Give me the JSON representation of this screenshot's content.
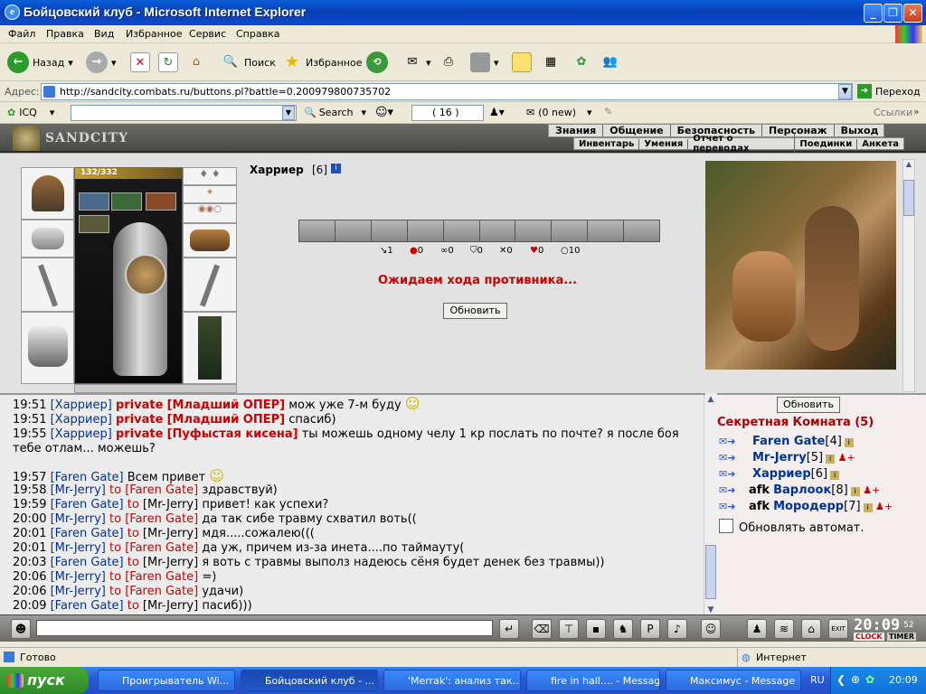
{
  "window": {
    "title": "Бойцовский клуб - Microsoft Internet Explorer"
  },
  "menu": [
    "Файл",
    "Правка",
    "Вид",
    "Избранное",
    "Сервис",
    "Справка"
  ],
  "toolbar": {
    "back": "Назад",
    "search": "Поиск",
    "favorites": "Избранное"
  },
  "address": {
    "label": "Адрес:",
    "url": "http://sandcity.combats.ru/buttons.pl?battle=0.200979800735702",
    "go": "Переход"
  },
  "linkbar": {
    "icq": "ICQ",
    "search": "Search",
    "count": "( 16 )",
    "mail": "(0 new)",
    "links": "Ссылки"
  },
  "game": {
    "logo": "SANDCITY",
    "nav_top": [
      "Знания",
      "Общение",
      "Безопасность",
      "Персонаж",
      "Выход"
    ],
    "nav_bottom": [
      "Инвентарь",
      "Умения",
      "Отчет о переводах",
      "Поединки",
      "Анкета"
    ],
    "hp": "132/332",
    "opponent": "Харриер",
    "opponent_level": "[6]",
    "stats": [
      "1",
      "0",
      "0",
      "0",
      "0",
      "0",
      "10"
    ],
    "waiting": "Ожидаем хода противника...",
    "refresh": "Обновить"
  },
  "chat": [
    {
      "time": "19:51",
      "from": "[Харриер]",
      "kind": "private",
      "to": "[Младший ОПЕР]",
      "msg": "мож уже 7-м буду"
    },
    {
      "time": "19:51",
      "from": "[Харриер]",
      "kind": "private",
      "to": "[Младший ОПЕР]",
      "msg": "спасиб)"
    },
    {
      "time": "19:55",
      "from": "[Харриер]",
      "kind": "private",
      "to": "[Пуфыстая кисена]",
      "msg": "ты можешь одному челу 1 кр послать по почте? я после боя"
    },
    {
      "time": "",
      "from": "",
      "kind": "cont",
      "to": "",
      "msg": "тебе отлам... можешь?"
    },
    {
      "time": "19:57",
      "from": "[Faren Gate]",
      "kind": "plain",
      "to": "",
      "msg": "Всем привет"
    },
    {
      "time": "19:58",
      "from": "[Mr-Jerry]",
      "kind": "to",
      "to": "[Faren Gate]",
      "msg": "здравствуй)"
    },
    {
      "time": "19:59",
      "from": "[Faren Gate]",
      "kind": "to",
      "to": "[Mr-Jerry]",
      "msg": "привет! как успехи?"
    },
    {
      "time": "20:00",
      "from": "[Mr-Jerry]",
      "kind": "to",
      "to": "[Faren Gate]",
      "msg": "да так сибе травму схватил воть(("
    },
    {
      "time": "20:01",
      "from": "[Faren Gate]",
      "kind": "to",
      "to": "[Mr-Jerry]",
      "msg": "мдя.....сожалею((("
    },
    {
      "time": "20:01",
      "from": "[Mr-Jerry]",
      "kind": "to",
      "to": "[Faren Gate]",
      "msg": "да уж, причем из-за инета....по таймауту("
    },
    {
      "time": "20:03",
      "from": "[Faren Gate]",
      "kind": "to",
      "to": "[Mr-Jerry]",
      "msg": "я воть с травмы выполз надеюсь сёня будет денек без травмы))"
    },
    {
      "time": "20:06",
      "from": "[Mr-Jerry]",
      "kind": "to",
      "to": "[Faren Gate]",
      "msg": "=)"
    },
    {
      "time": "20:06",
      "from": "[Mr-Jerry]",
      "kind": "to",
      "to": "[Faren Gate]",
      "msg": "удачи)"
    },
    {
      "time": "20:09",
      "from": "[Faren Gate]",
      "kind": "to",
      "to": "[Mr-Jerry]",
      "msg": "пасиб)))"
    }
  ],
  "to_word": "to",
  "private_word": "private",
  "room": {
    "refresh": "Обновить",
    "title": "Секретная Комната (5)",
    "users": [
      {
        "prefix": "",
        "name": "Faren Gate",
        "level": "[4]"
      },
      {
        "prefix": "",
        "name": "Mr-Jerry",
        "level": "[5]"
      },
      {
        "prefix": "",
        "name": "Харриер",
        "level": "[6]"
      },
      {
        "prefix": "afk",
        "name": "Варлоок",
        "level": "[8]"
      },
      {
        "prefix": "afk",
        "name": "Мородерр",
        "level": "[7]"
      }
    ],
    "auto": "Обновлять автомат."
  },
  "clock": {
    "time": "20:09",
    "sec": "52",
    "clock_label": "CLOCK",
    "timer_label": "TIMER"
  },
  "statusbar": {
    "ready": "Готово",
    "zone": "Интернет"
  },
  "taskbar": {
    "start": "пуск",
    "tasks": [
      "Проигрыватель Wi...",
      "Бойцовский клуб - ...",
      "'Merrak': анализ так...",
      "fire in hall.... - Message",
      "Максимус - Message"
    ],
    "lang": "RU",
    "time": "20:09"
  }
}
